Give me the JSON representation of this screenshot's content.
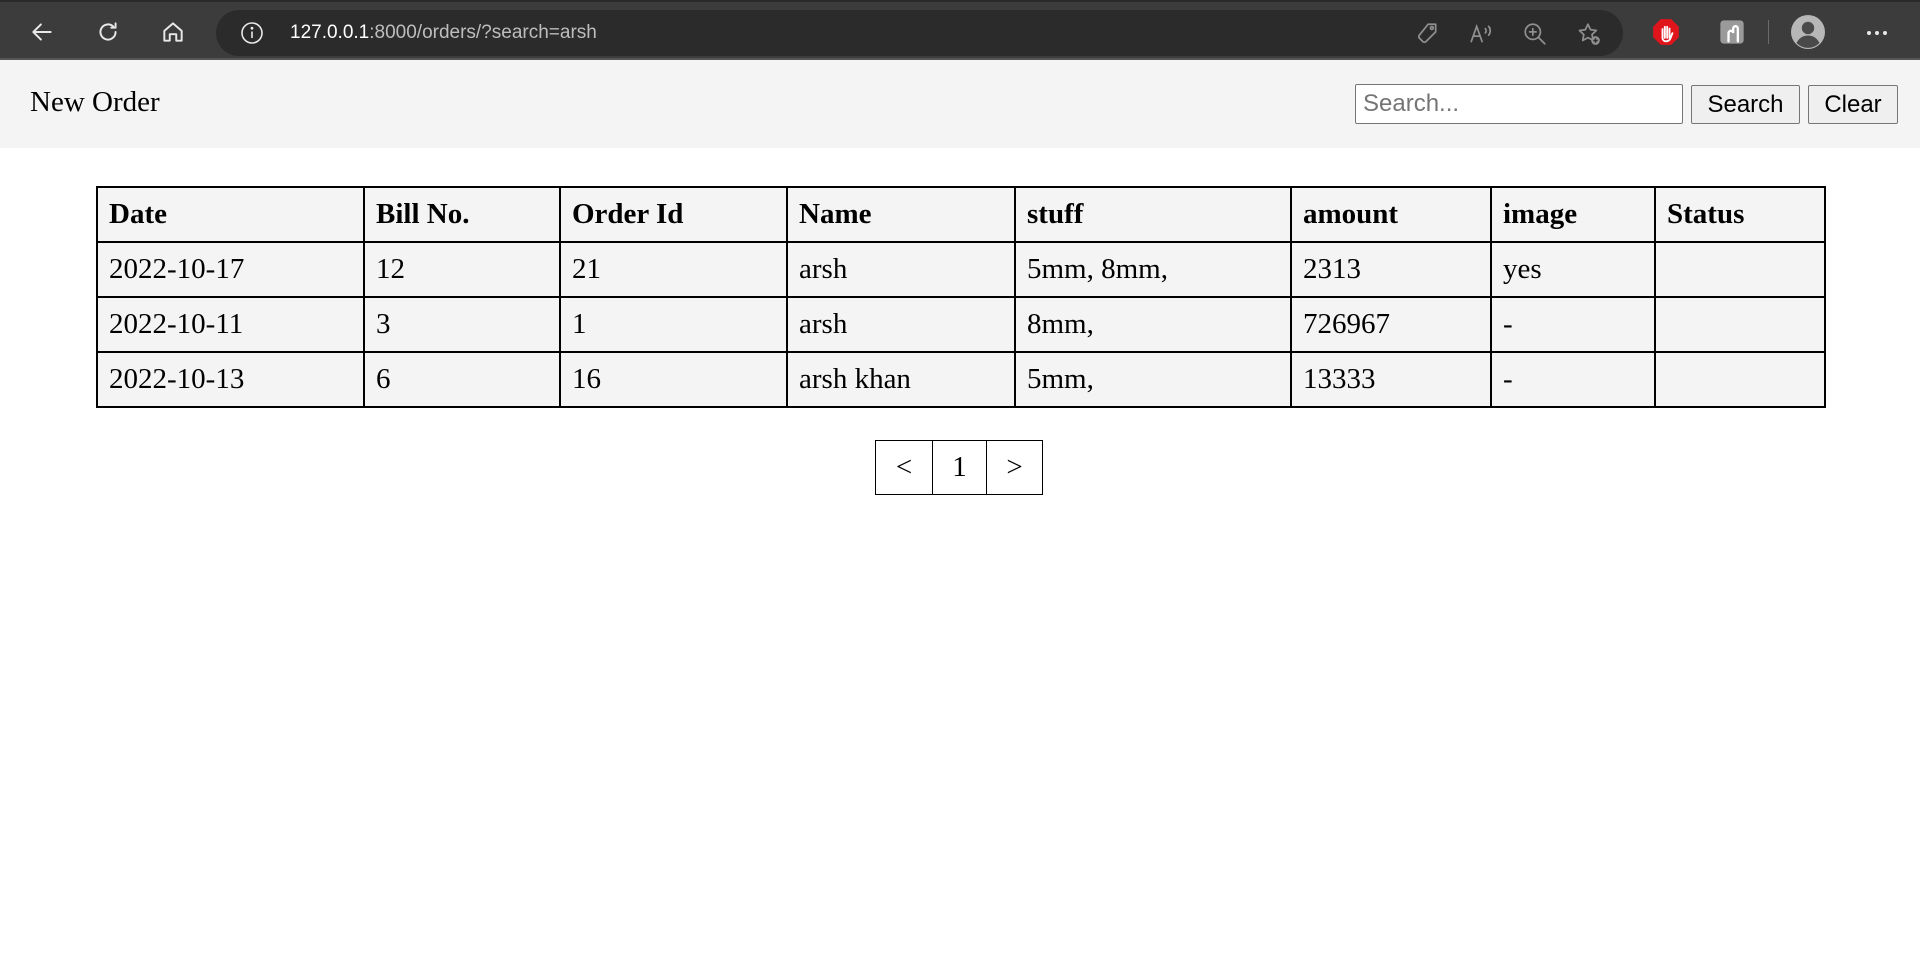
{
  "browser": {
    "url_host": "127.0.0.1",
    "url_rest": ":8000/orders/?search=arsh"
  },
  "header": {
    "new_order_label": "New Order",
    "search_placeholder": "Search...",
    "search_value": "",
    "search_button_label": "Search",
    "clear_button_label": "Clear"
  },
  "table": {
    "columns": [
      "Date",
      "Bill No.",
      "Order Id",
      "Name",
      "stuff",
      "amount",
      "image",
      "Status"
    ],
    "rows": [
      [
        "2022-10-17",
        "12",
        "21",
        "arsh",
        "5mm, 8mm,",
        "2313",
        "yes",
        ""
      ],
      [
        "2022-10-11",
        "3",
        "1",
        "arsh",
        "8mm,",
        "726967",
        "-",
        ""
      ],
      [
        "2022-10-13",
        "6",
        "16",
        "arsh khan",
        "5mm,",
        "13333",
        "-",
        ""
      ]
    ]
  },
  "pagination": {
    "prev_label": "<",
    "current_page": "1",
    "next_label": ">"
  },
  "icons": {
    "back": "back-arrow-icon",
    "refresh": "refresh-icon",
    "home": "home-icon",
    "site_info": "info-icon",
    "tracking": "tag-icon",
    "read_aloud": "read-aloud-icon",
    "zoom": "zoom-icon",
    "favorites": "add-favorite-icon",
    "adblock": "stop-hand-icon",
    "extension": "extension-icon",
    "profile": "profile-icon",
    "more": "more-icon"
  },
  "colors": {
    "browser_bar": "#3c3c3c",
    "address_bar": "#2b2b2b",
    "header_bg": "#f4f4f4",
    "cell_bg": "#f4f4f4",
    "adblock_red": "#e0151b"
  }
}
